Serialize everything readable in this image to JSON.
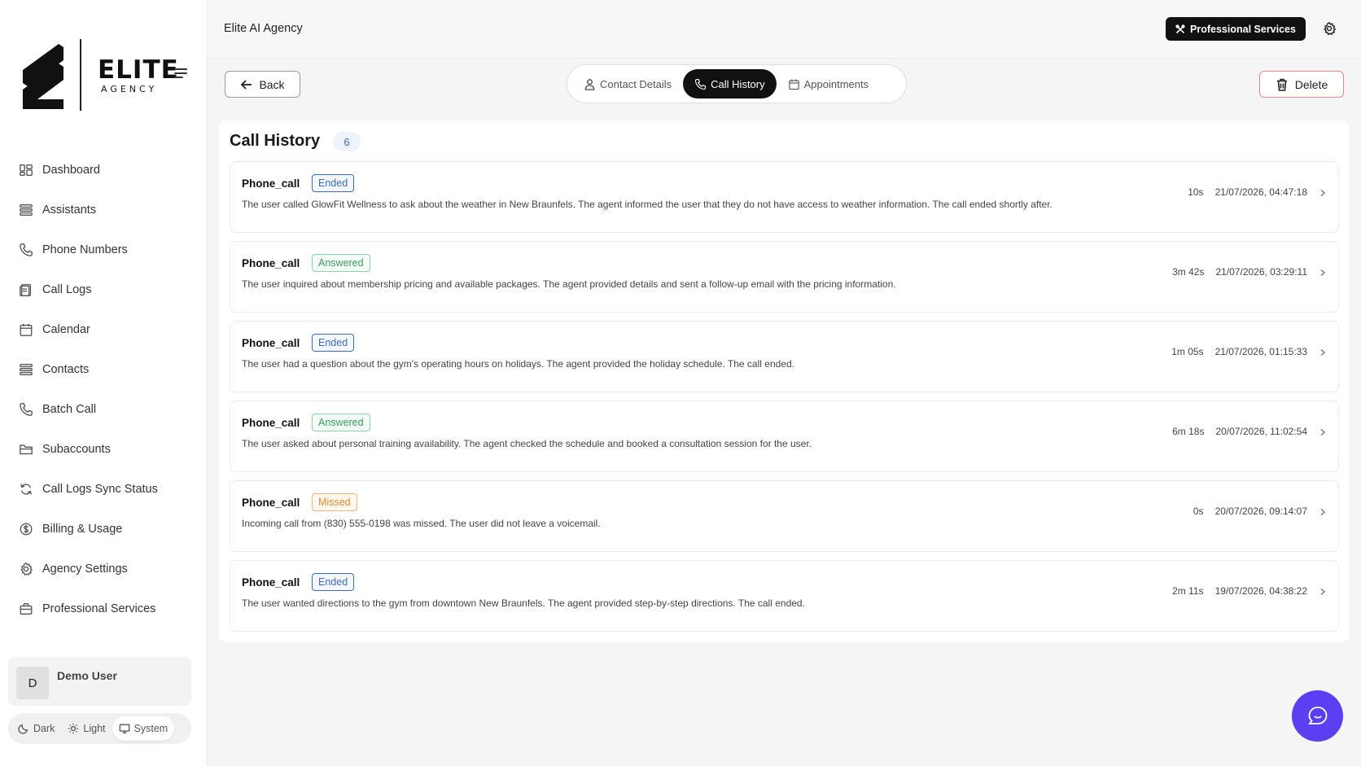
{
  "brand": {
    "name": "ELITE",
    "subtitle": "AGENCY"
  },
  "sidebar": {
    "items": [
      {
        "label": "Dashboard",
        "icon": "dashboard-icon"
      },
      {
        "label": "Assistants",
        "icon": "assistants-icon"
      },
      {
        "label": "Phone Numbers",
        "icon": "phone-icon"
      },
      {
        "label": "Call Logs",
        "icon": "call-logs-icon"
      },
      {
        "label": "Calendar",
        "icon": "calendar-icon"
      },
      {
        "label": "Contacts",
        "icon": "contacts-icon"
      },
      {
        "label": "Batch Call",
        "icon": "phone-icon"
      },
      {
        "label": "Subaccounts",
        "icon": "folder-icon"
      },
      {
        "label": "Call Logs Sync Status",
        "icon": "sync-icon"
      },
      {
        "label": "Billing & Usage",
        "icon": "dollar-icon"
      },
      {
        "label": "Agency Settings",
        "icon": "gear-icon"
      },
      {
        "label": "Professional Services",
        "icon": "briefcase-icon"
      }
    ]
  },
  "user": {
    "initial": "D",
    "name": "Demo User"
  },
  "theme": {
    "options": [
      "Dark",
      "Light",
      "System"
    ],
    "selected": "System"
  },
  "header": {
    "title": "Elite AI Agency",
    "pro_button": "Professional Services"
  },
  "toolbar": {
    "back_label": "Back",
    "delete_label": "Delete",
    "tabs": [
      "Contact Details",
      "Call History",
      "Appointments"
    ],
    "active_tab": "Call History"
  },
  "call_history": {
    "title": "Call History",
    "count": "6",
    "calls": [
      {
        "type": "Phone_call",
        "status": "Ended",
        "description": "The user called GlowFit Wellness to ask about the weather in New Braunfels. The agent informed the user that they do not have access to weather information. The call ended shortly after.",
        "duration": "10s",
        "timestamp": "21/07/2026, 04:47:18"
      },
      {
        "type": "Phone_call",
        "status": "Answered",
        "description": "The user inquired about membership pricing and available packages. The agent provided details and sent a follow-up email with the pricing information.",
        "duration": "3m 42s",
        "timestamp": "21/07/2026, 03:29:11"
      },
      {
        "type": "Phone_call",
        "status": "Ended",
        "description": "The user had a question about the gym's operating hours on holidays. The agent provided the holiday schedule. The call ended.",
        "duration": "1m 05s",
        "timestamp": "21/07/2026, 01:15:33"
      },
      {
        "type": "Phone_call",
        "status": "Answered",
        "description": "The user asked about personal training availability. The agent checked the schedule and booked a consultation session for the user.",
        "duration": "6m 18s",
        "timestamp": "20/07/2026, 11:02:54"
      },
      {
        "type": "Phone_call",
        "status": "Missed",
        "description": "Incoming call from (830) 555-0198 was missed. The user did not leave a voicemail.",
        "duration": "0s",
        "timestamp": "20/07/2026, 09:14:07"
      },
      {
        "type": "Phone_call",
        "status": "Ended",
        "description": "The user wanted directions to the gym from downtown New Braunfels. The agent provided step-by-step directions. The call ended.",
        "duration": "2m 11s",
        "timestamp": "19/07/2026, 04:38:22"
      }
    ]
  },
  "colors": {
    "accent_purple": "#5b3ff0",
    "status_ended": "#3a6bc4",
    "status_answered": "#3e9b62",
    "status_missed": "#e08a2e",
    "delete_border": "#e88888"
  }
}
